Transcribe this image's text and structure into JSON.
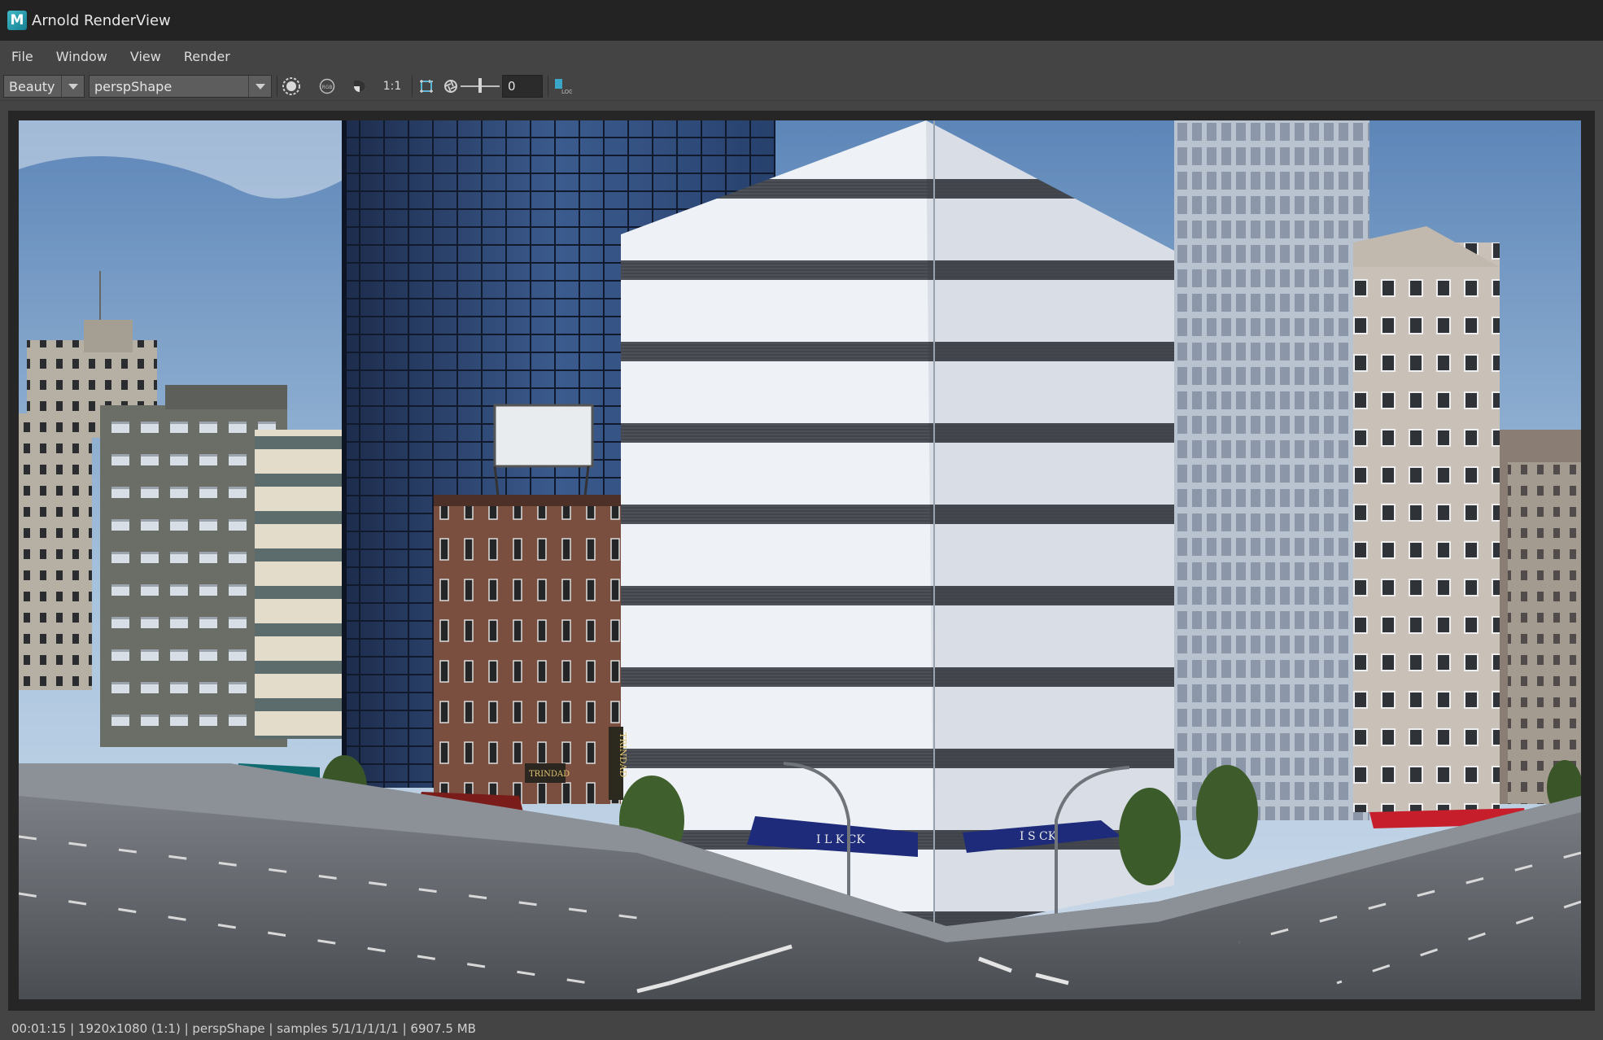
{
  "window": {
    "title": "Arnold RenderView",
    "app_icon_letter": "M"
  },
  "menubar": {
    "items": [
      "File",
      "Window",
      "View",
      "Render"
    ]
  },
  "toolbar": {
    "aov_dropdown": "Beauty",
    "camera_dropdown": "perspShape",
    "ratio_label": "1:1",
    "exposure_value": "0",
    "log_label": "LOG"
  },
  "status": {
    "text": "00:01:15 | 1920x1080 (1:1) | perspShape  | samples 5/1/1/1/1/1 | 6907.5 MB"
  },
  "render_signs": {
    "store_left": "I  L K  CK",
    "store_right": "I  S   CK",
    "trindad_vertical": "TRINDAD",
    "trindad_sign": "TRINDAD"
  }
}
